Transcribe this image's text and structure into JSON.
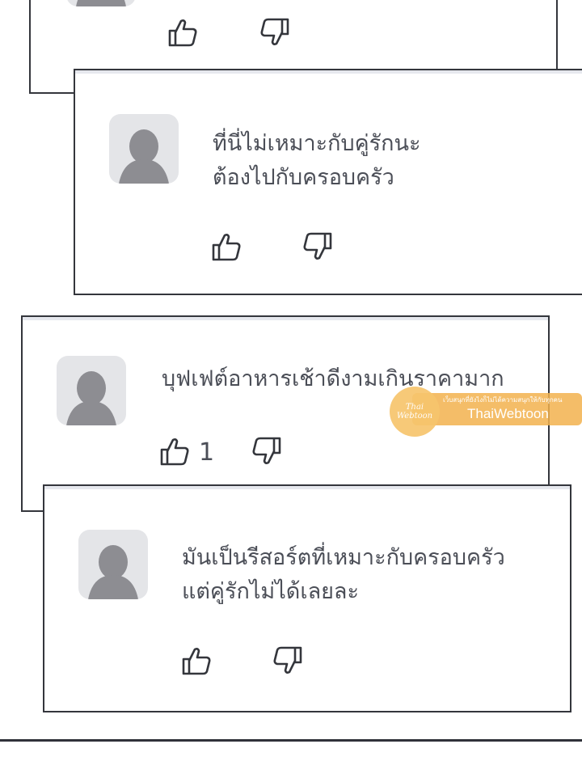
{
  "comments": [
    {
      "text_lines": [],
      "like_count": "",
      "like_icon": "thumbs-up-icon",
      "dislike_icon": "thumbs-down-icon"
    },
    {
      "text_lines": [
        "ที่นี่ไม่เหมาะกับคู่รักนะ",
        "ต้องไปกับครอบครัว"
      ],
      "like_count": "",
      "like_icon": "thumbs-up-icon",
      "dislike_icon": "thumbs-down-icon"
    },
    {
      "text_lines": [
        "บุฟเฟต์อาหารเช้าดีงามเกินราคามาก"
      ],
      "like_count": "1",
      "like_icon": "thumbs-up-icon",
      "dislike_icon": "thumbs-down-icon"
    },
    {
      "text_lines": [
        "มันเป็นรีสอร์ตที่เหมาะกับครอบครัว",
        "แต่คู่รักไม่ได้เลยละ"
      ],
      "like_count": "",
      "like_icon": "thumbs-up-icon",
      "dislike_icon": "thumbs-down-icon"
    }
  ],
  "watermark": {
    "circle_text": "Thai Webtoon",
    "tagline": "เว็บสนุกที่ยังไงก็ไม่ได้ความสนุกให้กับทุกคน",
    "brand": "ThaiWebtoon"
  },
  "colors": {
    "border": "#34363c",
    "text": "#4b4e57",
    "avatar_bg": "#e4e5e8",
    "avatar_figure": "#8d8d92",
    "watermark_orange": "#f2b24e"
  }
}
